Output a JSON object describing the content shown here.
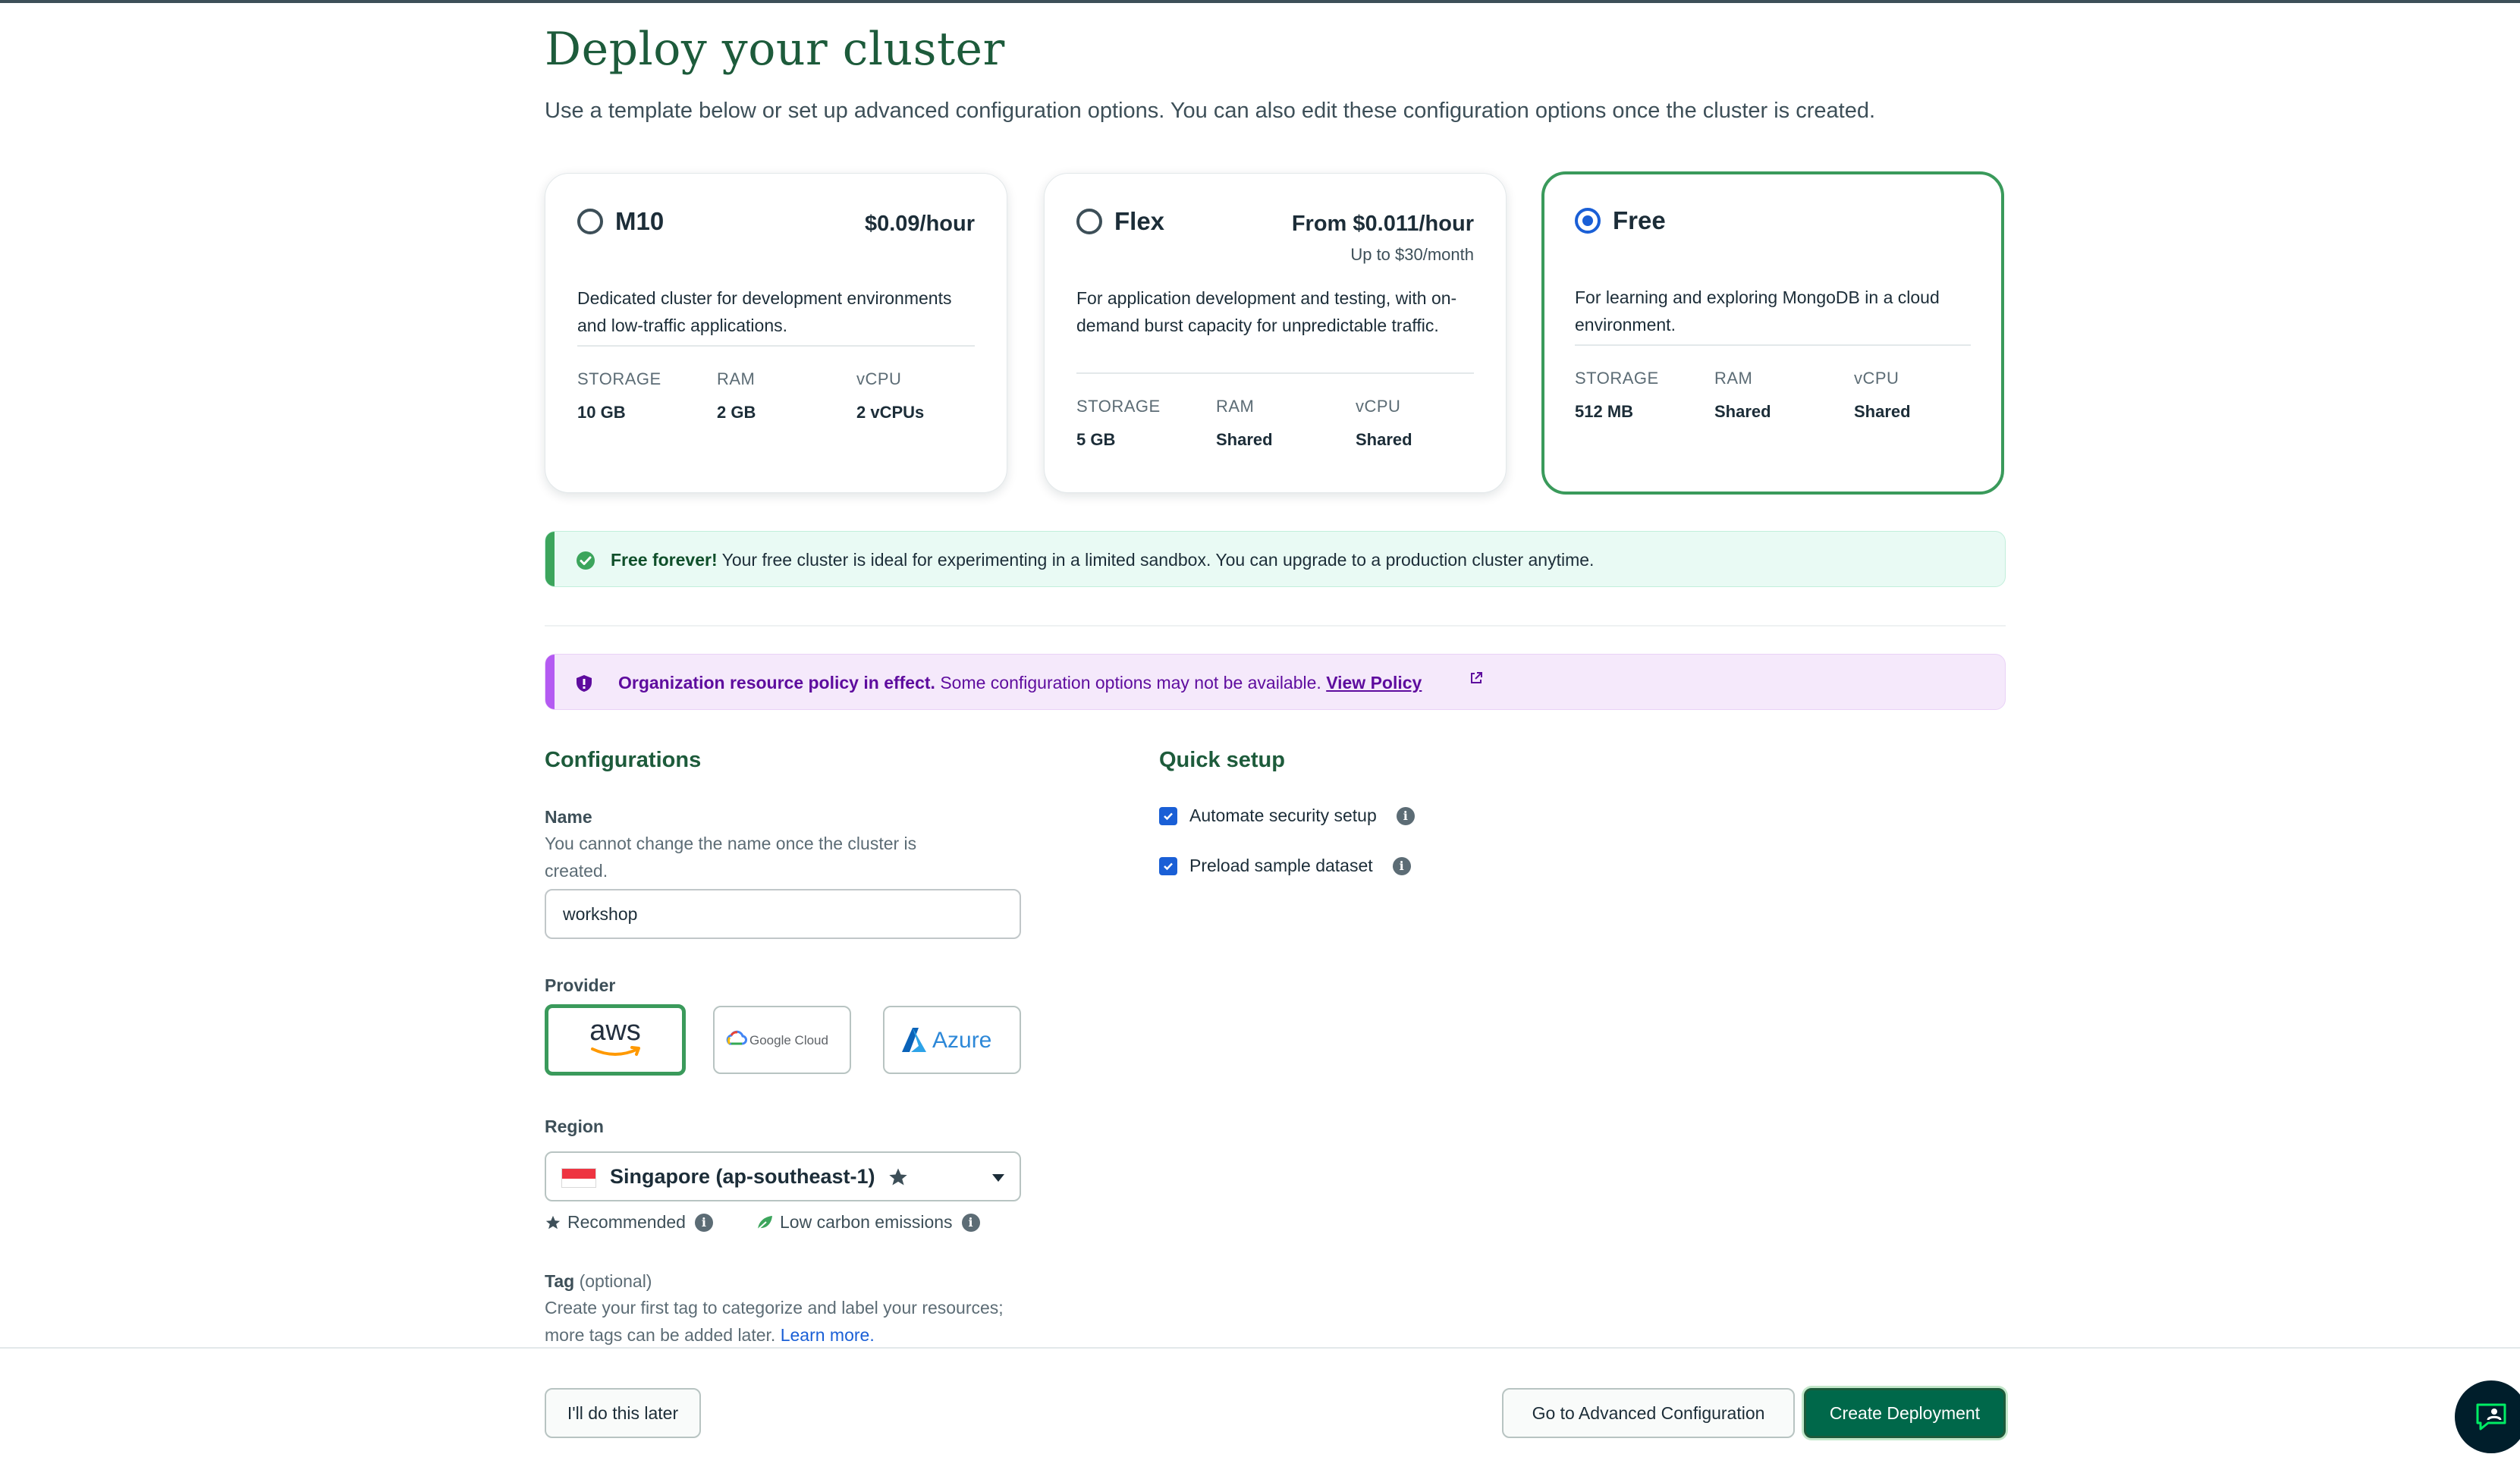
{
  "page": {
    "title": "Deploy your cluster",
    "subtitle": "Use a template below or set up advanced configuration options. You can also edit these configuration options once the cluster is created."
  },
  "tiers": [
    {
      "name": "M10",
      "price": "$0.09/hour",
      "price_sub": "",
      "description": "Dedicated cluster for development environments and low-traffic applications.",
      "selected": false,
      "specs": [
        {
          "label": "STORAGE",
          "value": "10 GB"
        },
        {
          "label": "RAM",
          "value": "2 GB"
        },
        {
          "label": "vCPU",
          "value": "2 vCPUs"
        }
      ]
    },
    {
      "name": "Flex",
      "price": "From $0.011/hour",
      "price_sub": "Up to $30/month",
      "description": "For application development and testing, with on-demand burst capacity for unpredictable traffic.",
      "selected": false,
      "specs": [
        {
          "label": "STORAGE",
          "value": "5 GB"
        },
        {
          "label": "RAM",
          "value": "Shared"
        },
        {
          "label": "vCPU",
          "value": "Shared"
        }
      ]
    },
    {
      "name": "Free",
      "price": "",
      "price_sub": "",
      "description": "For learning and exploring MongoDB in a cloud environment.",
      "selected": true,
      "specs": [
        {
          "label": "STORAGE",
          "value": "512 MB"
        },
        {
          "label": "RAM",
          "value": "Shared"
        },
        {
          "label": "vCPU",
          "value": "Shared"
        }
      ]
    }
  ],
  "banners": {
    "free": {
      "bold": "Free forever!",
      "text": " Your free cluster is ideal for experimenting in a limited sandbox. You can upgrade to a production cluster anytime.",
      "color": "#3ca55c"
    },
    "policy": {
      "bold": "Organization resource policy in effect.",
      "text": " Some configuration options may not be available. ",
      "link": "View Policy",
      "color": "#b45af2"
    }
  },
  "configurations": {
    "title": "Configurations",
    "name_label": "Name",
    "name_help": "You cannot change the name once the cluster is created.",
    "name_value": "workshop",
    "provider_label": "Provider",
    "providers": [
      {
        "name": "aws",
        "selected": true
      },
      {
        "name": "Google Cloud",
        "selected": false
      },
      {
        "name": "Azure",
        "selected": false
      }
    ],
    "region_label": "Region",
    "region_value": "Singapore (ap-southeast-1)",
    "recommended": "Recommended",
    "low_carbon": "Low carbon emissions",
    "tag_label": "Tag",
    "tag_optional": "(optional)",
    "tag_help": "Create your first tag to categorize and label your resources; more tags can be added later.",
    "tag_link": "Learn more."
  },
  "quick_setup": {
    "title": "Quick setup",
    "options": [
      {
        "label": "Automate security setup",
        "checked": true
      },
      {
        "label": "Preload sample dataset",
        "checked": true
      }
    ]
  },
  "footer": {
    "later": "I'll do this later",
    "advanced": "Go to Advanced Configuration",
    "create": "Create Deployment"
  },
  "colors": {
    "brand_green": "#1d5b3b",
    "accent_green": "#3a9a5b",
    "primary_button": "#00684a",
    "radio_blue": "#1a5fd6"
  }
}
